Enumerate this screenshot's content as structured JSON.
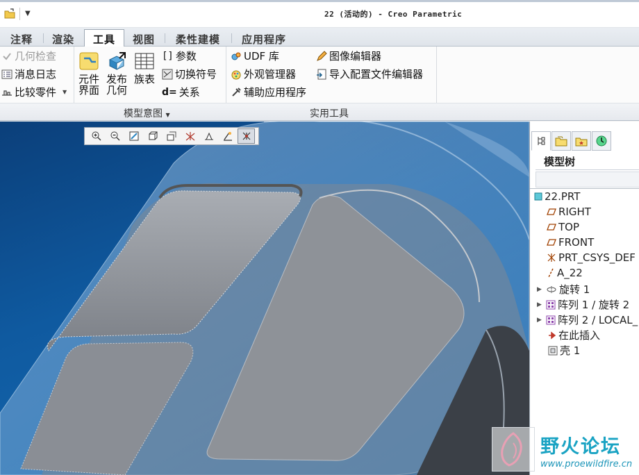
{
  "window": {
    "title": "22 (活动的) - Creo Parametric"
  },
  "quick_access": {
    "open_icon": "folder-open-icon",
    "menu_icon": "dropdown-arrow-icon"
  },
  "tabs": [
    {
      "label": "注释"
    },
    {
      "label": "渲染"
    },
    {
      "label": "工具",
      "active": true
    },
    {
      "label": "视图"
    },
    {
      "label": "柔性建模"
    },
    {
      "label": "应用程序"
    }
  ],
  "ribbon": {
    "col1": {
      "geometry_check": "几何检查",
      "message_log": "消息日志",
      "compare_part": "比较零件"
    },
    "big_buttons": {
      "component_interface": [
        "元件",
        "界面"
      ],
      "publish_geometry": [
        "发布",
        "几何"
      ],
      "family_table": "族表"
    },
    "col3": {
      "parameters": "参数",
      "switch_symbols": "切换符号",
      "relations": "关系"
    },
    "col4": {
      "udf_library": "UDF 库",
      "appearance_manager": "外观管理器",
      "auxiliary_app": "辅助应用程序"
    },
    "col5": {
      "image_editor": "图像编辑器",
      "import_config_editor": "导入配置文件编辑器"
    },
    "groups": {
      "model_intent": "模型意图",
      "utilities": "实用工具"
    }
  },
  "view_toolbar": [
    {
      "icon": "zoom-in-icon"
    },
    {
      "icon": "zoom-out-icon"
    },
    {
      "icon": "refit-icon"
    },
    {
      "icon": "display-style-icon"
    },
    {
      "icon": "saved-views-icon"
    },
    {
      "icon": "datum-display-icon"
    },
    {
      "icon": "spin-center-icon"
    },
    {
      "icon": "annotation-display-icon"
    },
    {
      "icon": "csys-display-icon"
    }
  ],
  "model_tree": {
    "title": "模型树",
    "items": [
      {
        "label": "22.PRT",
        "icon": "part-icon",
        "expandable": false
      },
      {
        "label": "RIGHT",
        "icon": "datum-plane-icon",
        "expandable": false
      },
      {
        "label": "TOP",
        "icon": "datum-plane-icon",
        "expandable": false
      },
      {
        "label": "FRONT",
        "icon": "datum-plane-icon",
        "expandable": false
      },
      {
        "label": "PRT_CSYS_DEF",
        "icon": "csys-icon",
        "expandable": false
      },
      {
        "label": "A_22",
        "icon": "axis-icon",
        "expandable": false
      },
      {
        "label": "旋转 1",
        "icon": "revolve-icon",
        "expandable": true
      },
      {
        "label": "阵列 1 / 旋转 2",
        "icon": "pattern-icon",
        "expandable": true
      },
      {
        "label": "阵列 2 / LOCAL_",
        "icon": "pattern-icon",
        "expandable": true
      },
      {
        "label": "在此插入",
        "icon": "insert-here-icon",
        "expandable": false
      },
      {
        "label": "壳 1",
        "icon": "shell-icon",
        "expandable": false
      }
    ]
  },
  "watermark": {
    "name": "野火论坛",
    "url": "www.proewildfire.cn"
  },
  "colors": {
    "viewport_bg": "#0f5aa0",
    "model_gray": "#8c9097",
    "watermark": "#1aa3c3"
  }
}
